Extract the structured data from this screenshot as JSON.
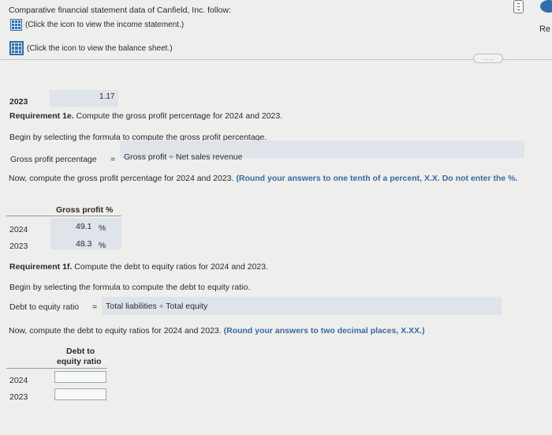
{
  "header": {
    "title": "Comparative financial statement data of Canfield, Inc. follow:",
    "income_link": "(Click the icon to view the income statement.)",
    "balance_link": "(Click the icon to view the balance sheet.)",
    "right_label": "Re"
  },
  "divider": {
    "pill_text": "....."
  },
  "previous": {
    "year": "2023",
    "value": "1.17"
  },
  "req_1e": {
    "heading_bold": "Requirement 1e.",
    "heading_text": " Compute the gross profit percentage for 2024 and 2023.",
    "begin_text": "Begin by selecting the formula to compute the gross profit percentage.",
    "formula_label": "Gross profit percentage",
    "formula_eq": "=",
    "formula_value": "Gross profit ÷ Net sales revenue",
    "now_text": "Now, compute the gross profit percentage for 2024 and 2023.",
    "round_note": "(Round your answers to one tenth of a percent, X.X. Do not enter the %.",
    "column_header": "Gross profit %",
    "rows": [
      {
        "year": "2024",
        "value": "49.1",
        "unit": "%"
      },
      {
        "year": "2023",
        "value": "48.3",
        "unit": "%"
      }
    ]
  },
  "req_1f": {
    "heading_bold": "Requirement 1f.",
    "heading_text": " Compute the debt to equity ratios for 2024 and 2023.",
    "begin_text": "Begin by selecting the formula to compute the debt to equity ratio.",
    "formula_label": "Debt to equity ratio",
    "formula_eq": "=",
    "formula_value": "Total liabilities ÷ Total equity",
    "now_text": "Now, compute the debt to equity ratios for 2024 and 2023.",
    "round_note": "(Round your answers to two decimal places, X.XX.)",
    "column_header_line1": "Debt to",
    "column_header_line2": "equity ratio",
    "rows": [
      {
        "year": "2024",
        "value": ""
      },
      {
        "year": "2023",
        "value": ""
      }
    ]
  },
  "icons": {
    "statement": "grid-table-icon",
    "scroll": "scroll-handle-icon"
  },
  "colors": {
    "accent": "#2f6ea8",
    "answer_shade": "#e2e6ec",
    "background": "#eeeeec"
  }
}
